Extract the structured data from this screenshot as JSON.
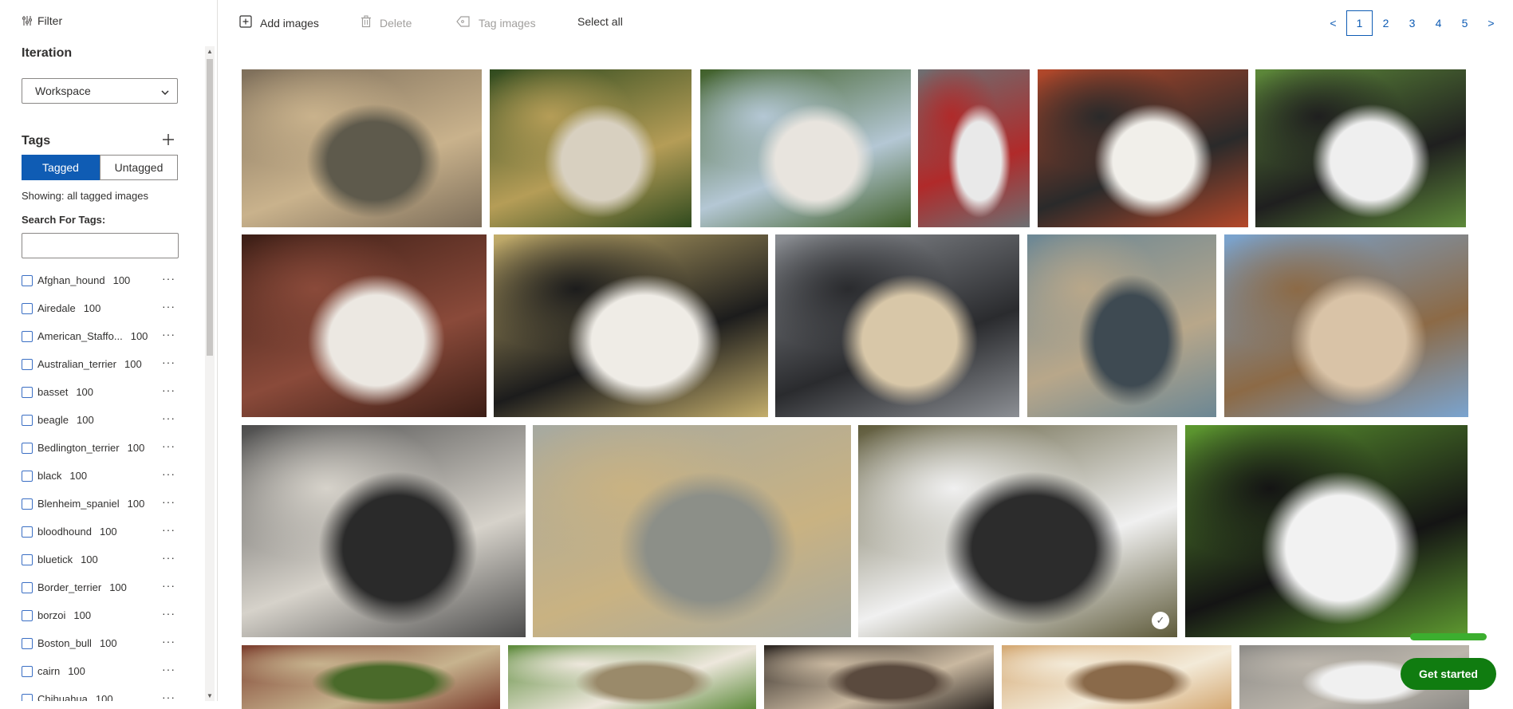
{
  "left_panel": {
    "filter_label": "Filter",
    "iteration_title": "Iteration",
    "iteration_value": "Workspace",
    "tags_title": "Tags",
    "toggle": {
      "tagged": "Tagged",
      "untagged": "Untagged"
    },
    "showing": "Showing: all tagged images",
    "search_label": "Search For Tags:",
    "search_value": "",
    "tags": [
      {
        "name": "Afghan_hound",
        "count": "100"
      },
      {
        "name": "Airedale",
        "count": "100"
      },
      {
        "name": "American_Staffo...",
        "count": "100"
      },
      {
        "name": "Australian_terrier",
        "count": "100"
      },
      {
        "name": "basset",
        "count": "100"
      },
      {
        "name": "beagle",
        "count": "100"
      },
      {
        "name": "Bedlington_terrier",
        "count": "100"
      },
      {
        "name": "black",
        "count": "100"
      },
      {
        "name": "Blenheim_spaniel",
        "count": "100"
      },
      {
        "name": "bloodhound",
        "count": "100"
      },
      {
        "name": "bluetick",
        "count": "100"
      },
      {
        "name": "Border_terrier",
        "count": "100"
      },
      {
        "name": "borzoi",
        "count": "100"
      },
      {
        "name": "Boston_bull",
        "count": "100"
      },
      {
        "name": "cairn",
        "count": "100"
      },
      {
        "name": "Chihuahua",
        "count": "100"
      }
    ],
    "more_glyph": "···"
  },
  "toolbar": {
    "add_images": "Add images",
    "delete": "Delete",
    "tag_images": "Tag images",
    "select_all": "Select all"
  },
  "pagination": {
    "prev": "<",
    "pages": [
      "1",
      "2",
      "3",
      "4",
      "5"
    ],
    "current": "1",
    "next": ">"
  },
  "grid": {
    "photos": [
      {
        "row": 1,
        "colors": [
          "#7d6e5a",
          "#c9b28c",
          "#5e5a4c"
        ],
        "selected": false
      },
      {
        "row": 1,
        "colors": [
          "#2f4a1e",
          "#b59d57",
          "#d8d0c0"
        ],
        "selected": false
      },
      {
        "row": 1,
        "colors": [
          "#3f5f28",
          "#b4c7d4",
          "#e8e4de"
        ],
        "selected": false
      },
      {
        "row": 1,
        "colors": [
          "#6d6f72",
          "#b02a2a",
          "#e9e9e9"
        ],
        "selected": false
      },
      {
        "row": 1,
        "colors": [
          "#b4482a",
          "#2a2a2a",
          "#f1efea"
        ],
        "selected": false
      },
      {
        "row": 1,
        "colors": [
          "#5e8a3a",
          "#1f1f1f",
          "#efefef"
        ],
        "selected": false
      },
      {
        "row": 2,
        "colors": [
          "#3c1e16",
          "#8a4a3a",
          "#ece8e2"
        ],
        "selected": false
      },
      {
        "row": 2,
        "colors": [
          "#c4ae6c",
          "#1c1c1c",
          "#efece6"
        ],
        "selected": false
      },
      {
        "row": 2,
        "colors": [
          "#8c8f94",
          "#2a2b2e",
          "#d8c7a8"
        ],
        "selected": false
      },
      {
        "row": 2,
        "colors": [
          "#6c8794",
          "#b8a78a",
          "#3e4a52"
        ],
        "selected": false
      },
      {
        "row": 2,
        "colors": [
          "#7aa4d0",
          "#8c6a46",
          "#d9c3a7"
        ],
        "selected": false
      },
      {
        "row": 3,
        "colors": [
          "#4c4c4c",
          "#d6d2ca",
          "#2a2a2a"
        ],
        "selected": false
      },
      {
        "row": 3,
        "colors": [
          "#a6a9a0",
          "#c9b282",
          "#8c8f88"
        ],
        "selected": false
      },
      {
        "row": 3,
        "colors": [
          "#5e5a3a",
          "#f0f0f0",
          "#2c2c2c"
        ],
        "selected": true
      },
      {
        "row": 3,
        "colors": [
          "#5e9a30",
          "#141414",
          "#f2f2f2"
        ],
        "selected": false
      },
      {
        "row": 4,
        "colors": [
          "#7c3e2e",
          "#c7b38e",
          "#4a6a2a"
        ],
        "selected": false
      },
      {
        "row": 4,
        "colors": [
          "#5c8a3a",
          "#ede7dc",
          "#9a8a6a"
        ],
        "selected": false
      },
      {
        "row": 4,
        "colors": [
          "#2a2420",
          "#c9b8a0",
          "#5a4a3e"
        ],
        "selected": false
      },
      {
        "row": 4,
        "colors": [
          "#d4a872",
          "#f3ead8",
          "#8a6a4a"
        ],
        "selected": false
      },
      {
        "row": 4,
        "colors": [
          "#8c8a86",
          "#bcb6ac",
          "#f0f0f0"
        ],
        "selected": false
      }
    ]
  },
  "get_started": "Get started",
  "colors": {
    "accent": "#0f5cb4",
    "cta": "#107c10"
  },
  "icons": [
    "filter-icon",
    "plus-icon",
    "chevron-down-icon",
    "add-image-icon",
    "trash-icon",
    "tag-icon",
    "checkmark-icon"
  ]
}
